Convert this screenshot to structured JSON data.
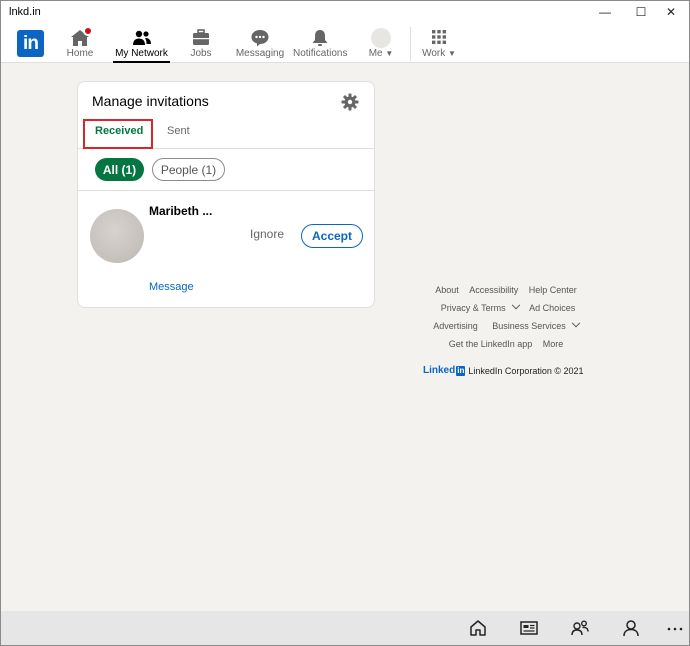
{
  "window": {
    "title": "lnkd.in",
    "minimize": "—",
    "maximize": "☐",
    "close": "✕"
  },
  "nav": {
    "logo": "in",
    "items": [
      {
        "label": "Home",
        "icon": "home-icon"
      },
      {
        "label": "My Network",
        "icon": "network-icon"
      },
      {
        "label": "Jobs",
        "icon": "briefcase-icon"
      },
      {
        "label": "Messaging",
        "icon": "chat-icon"
      },
      {
        "label": "Notifications",
        "icon": "bell-icon"
      },
      {
        "label": "Me",
        "icon": "avatar"
      },
      {
        "label": "Work",
        "icon": "grid-icon"
      }
    ]
  },
  "invitations": {
    "title": "Manage invitations",
    "tabs": {
      "received": "Received",
      "sent": "Sent"
    },
    "filters": {
      "all": "All (1)",
      "people": "People (1)"
    },
    "items": [
      {
        "name": "Maribeth ...",
        "ignore": "Ignore",
        "accept": "Accept",
        "message": "Message"
      }
    ]
  },
  "footer": {
    "row1": [
      "About",
      "Accessibility",
      "Help Center"
    ],
    "row2": [
      "Privacy & Terms",
      "Ad Choices"
    ],
    "row3": [
      "Advertising",
      "Business Services"
    ],
    "row4": [
      "Get the LinkedIn app",
      "More"
    ],
    "brand_word": "Linked",
    "brand_in": "in",
    "copyright": "LinkedIn Corporation © 2021"
  },
  "colors": {
    "brand_blue": "#0a66c2",
    "green": "#057642",
    "highlight_red": "#d9252b",
    "notification_red": "#cc1016"
  }
}
